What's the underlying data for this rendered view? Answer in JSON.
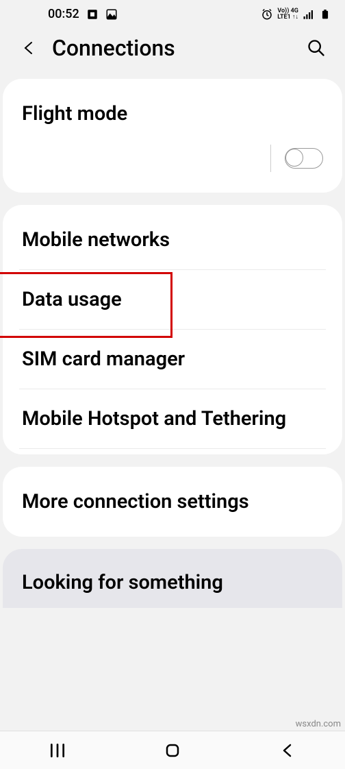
{
  "status": {
    "time": "00:52",
    "lte_label_top": "Vo)) 4G",
    "lte_label_bot": "LTE1 ↑↓"
  },
  "header": {
    "title": "Connections"
  },
  "card1": {
    "flight_mode": "Flight mode"
  },
  "card2": {
    "mobile_networks": "Mobile networks",
    "data_usage": "Data usage",
    "sim_manager": "SIM card manager",
    "hotspot": "Mobile Hotspot and Tethering"
  },
  "card3": {
    "more_settings": "More connection settings"
  },
  "search_prompt": "Looking for something",
  "watermark": "wsxdn.com"
}
